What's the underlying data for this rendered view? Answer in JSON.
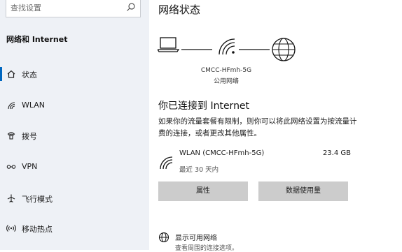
{
  "sidebar": {
    "search_placeholder": "查找设置",
    "section_title": "网络和 Internet",
    "items": [
      {
        "label": "状态",
        "icon": "home-icon",
        "active": true
      },
      {
        "label": "WLAN",
        "icon": "wifi-icon",
        "active": false
      },
      {
        "label": "拨号",
        "icon": "phone-icon",
        "active": false
      },
      {
        "label": "VPN",
        "icon": "vpn-icon",
        "active": false
      },
      {
        "label": "飞行模式",
        "icon": "airplane-icon",
        "active": false
      },
      {
        "label": "移动热点",
        "icon": "hotspot-icon",
        "active": false
      }
    ]
  },
  "main": {
    "title": "网络状态",
    "network_name": "CMCC-HFmh-5G",
    "network_type": "公用网络",
    "status_title": "你已连接到 Internet",
    "status_desc": "如果你的流量套餐有限制，则你可以将此网络设置为按流量计费的连接，或者更改其他属性。",
    "connection": {
      "name": "WLAN (CMCC-HFmh-5G)",
      "recent": "最近 30 天内",
      "usage": "23.4 GB"
    },
    "buttons": {
      "properties": "属性",
      "data_usage": "数据使用量"
    },
    "available": {
      "label": "显示可用网络",
      "sub": "查看周围的连接选项。"
    }
  },
  "colors": {
    "accent": "#0067c0",
    "sidebar_bg": "#eef1f6",
    "button_bg": "#cccccc"
  }
}
